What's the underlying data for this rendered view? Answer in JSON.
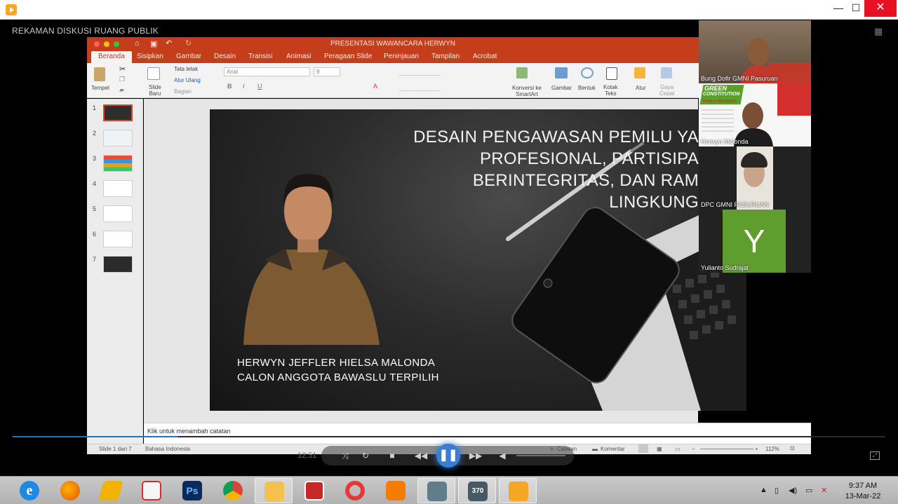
{
  "window": {
    "min": "—",
    "max": "☐",
    "close": "✕"
  },
  "player": {
    "video_title": "REKAMAN DISKUSI RUANG PUBLIK",
    "current_time": "12:51",
    "progress": 0.19,
    "fullscreen_icon": "expand-icon"
  },
  "ppt": {
    "title": "PRESENTASI WAWANCARA HERWYN",
    "tabs": [
      "Beranda",
      "Sisipkan",
      "Gambar",
      "Desain",
      "Transisi",
      "Animasi",
      "Peragaan Slide",
      "Peninjauan",
      "Tampilan",
      "Acrobat"
    ],
    "active_tab": "Beranda",
    "ribbon": {
      "paste": "Tempel",
      "new_slide_1": "Slide",
      "new_slide_2": "Baru",
      "layout": "Tata letak",
      "reset": "Atur Ulang",
      "section": "Bagian",
      "font_name": "Arial",
      "font_size": "9",
      "convert_1": "Konversi ke",
      "convert_2": "SmartArt",
      "picture": "Gambar",
      "shapes": "Bentuk",
      "textbox_1": "Kotak",
      "textbox_2": "Teks",
      "arrange": "Atur",
      "quick_1": "Gaya",
      "quick_2": "Cepat"
    },
    "thumb_numbers": [
      "1",
      "2",
      "3",
      "4",
      "5",
      "6",
      "7"
    ],
    "notes_placeholder": "Klik untuk menambah catatan",
    "status": {
      "slide_counter": "Slide 1 dari 7",
      "language": "Bahasa Indonesia",
      "notes": "Catatan",
      "comments": "Komentar",
      "zoom": "112%"
    },
    "accent_color": "#c43e1c"
  },
  "slide": {
    "title": "DESAIN PENGAWASAN PEMILU YA\nPROFESIONAL, PARTISIPA\nBERINTEGRITAS, DAN RAM\nLINGKUNG",
    "caption": "HERWYN JEFFLER HIELSA MALONDA\nCALON ANGGOTA BAWASLU TERPILIH"
  },
  "participants": [
    {
      "name": "Bung Dofir GMNI Pasuruan"
    },
    {
      "name": "Herwyn Malonda",
      "banner_1": "GREEN",
      "banner_2": "CONSTITUTION",
      "banner_3": "PEMILU INDONESIA"
    },
    {
      "name": "DPC GMNI PASURUAN"
    },
    {
      "name": "Yulianto Sudrajat",
      "initial": "Y"
    }
  ],
  "taskbar": {
    "apps": [
      {
        "icon": "internet-explorer-icon",
        "glyph": "e",
        "color": "#1e88e5"
      },
      {
        "icon": "firefox-icon",
        "glyph": "",
        "color": "#e66000"
      },
      {
        "icon": "winamp-icon",
        "glyph": "",
        "color": "#f0b400"
      },
      {
        "icon": "red-app-icon",
        "glyph": "",
        "color": "#d32f2f"
      },
      {
        "icon": "photoshop-icon",
        "glyph": "Ps",
        "color": "#0a2a5c"
      },
      {
        "icon": "chrome-icon",
        "glyph": "",
        "color": "#4caf50"
      },
      {
        "icon": "file-explorer-icon",
        "glyph": "",
        "color": "#f2c14e"
      },
      {
        "icon": "camera-icon",
        "glyph": "",
        "color": "#c62828"
      },
      {
        "icon": "opera-icon",
        "glyph": "",
        "color": "#e53935"
      },
      {
        "icon": "uc-browser-icon",
        "glyph": "",
        "color": "#f57c00"
      },
      {
        "icon": "drive-icon",
        "glyph": "",
        "color": "#607d8b"
      },
      {
        "icon": "clapper-icon",
        "glyph": "370",
        "color": "#455a64"
      },
      {
        "icon": "media-player-icon",
        "glyph": "",
        "color": "#f5a623"
      }
    ],
    "time": "9:37 AM",
    "date": "13-Mar-22"
  }
}
